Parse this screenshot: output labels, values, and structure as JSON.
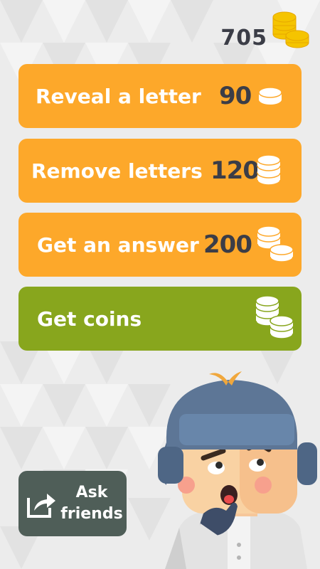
{
  "header": {
    "coins": "705",
    "coins_icon": "coin-stack-icon"
  },
  "hints": [
    {
      "label": "Reveal a letter",
      "price": "90",
      "icon": "single-coin-icon"
    },
    {
      "label": "Remove letters",
      "price": "120",
      "icon": "coin-stack-icon"
    },
    {
      "label": "Get an answer",
      "price": "200",
      "icon": "coin-stacks-icon"
    }
  ],
  "get_coins": {
    "label": "Get coins",
    "icon": "coin-stacks-icon"
  },
  "ask_friends": {
    "label_line1": "Ask",
    "label_line2": "friends",
    "icon": "share-icon"
  },
  "colors": {
    "orange": "#fda82a",
    "green": "#88a61d",
    "dark": "#3b3d47",
    "ask_bg": "#4f5e58"
  }
}
